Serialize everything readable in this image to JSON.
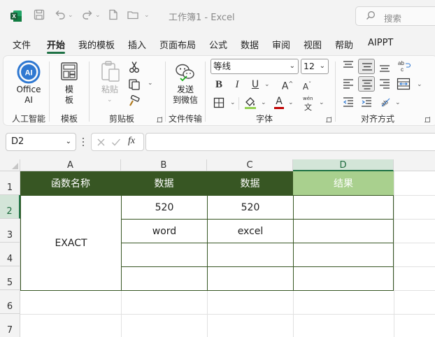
{
  "titlebar": {
    "title": "工作簿1 - Excel",
    "search_placeholder": "搜索"
  },
  "menu": {
    "items": [
      "文件",
      "开始",
      "我的模板",
      "插入",
      "页面布局",
      "公式",
      "数据",
      "审阅",
      "视图",
      "帮助",
      "AIPPT"
    ],
    "active": "开始"
  },
  "ribbon": {
    "ai": {
      "label_line1": "Office",
      "label_line2": "AI",
      "group": "人工智能"
    },
    "template": {
      "label_line1": "模",
      "label_line2": "板",
      "group": "模板"
    },
    "clipboard": {
      "paste": "粘贴",
      "group": "剪贴板"
    },
    "transfer": {
      "label_line1": "发送",
      "label_line2": "到微信",
      "group": "文件传输"
    },
    "font": {
      "name": "等线",
      "size": "12",
      "group": "字体",
      "phonetic_top": "wén",
      "phonetic_bottom": "文"
    },
    "align": {
      "group": "对齐方式"
    }
  },
  "formula_bar": {
    "name_box": "D2",
    "fx": "fx",
    "value": ""
  },
  "sheet": {
    "columns": [
      "A",
      "B",
      "C",
      "D"
    ],
    "rows": [
      "1",
      "2",
      "3",
      "4",
      "5",
      "6",
      "7"
    ],
    "header_row": [
      "函数名称",
      "数据",
      "数据",
      "结果"
    ],
    "merged_a": "EXACT",
    "b2": "520",
    "c2": "520",
    "b3": "word",
    "c3": "excel"
  },
  "colors": {
    "accent": "#217346",
    "header_fill": "#375623",
    "result_fill": "#a9d08e"
  }
}
